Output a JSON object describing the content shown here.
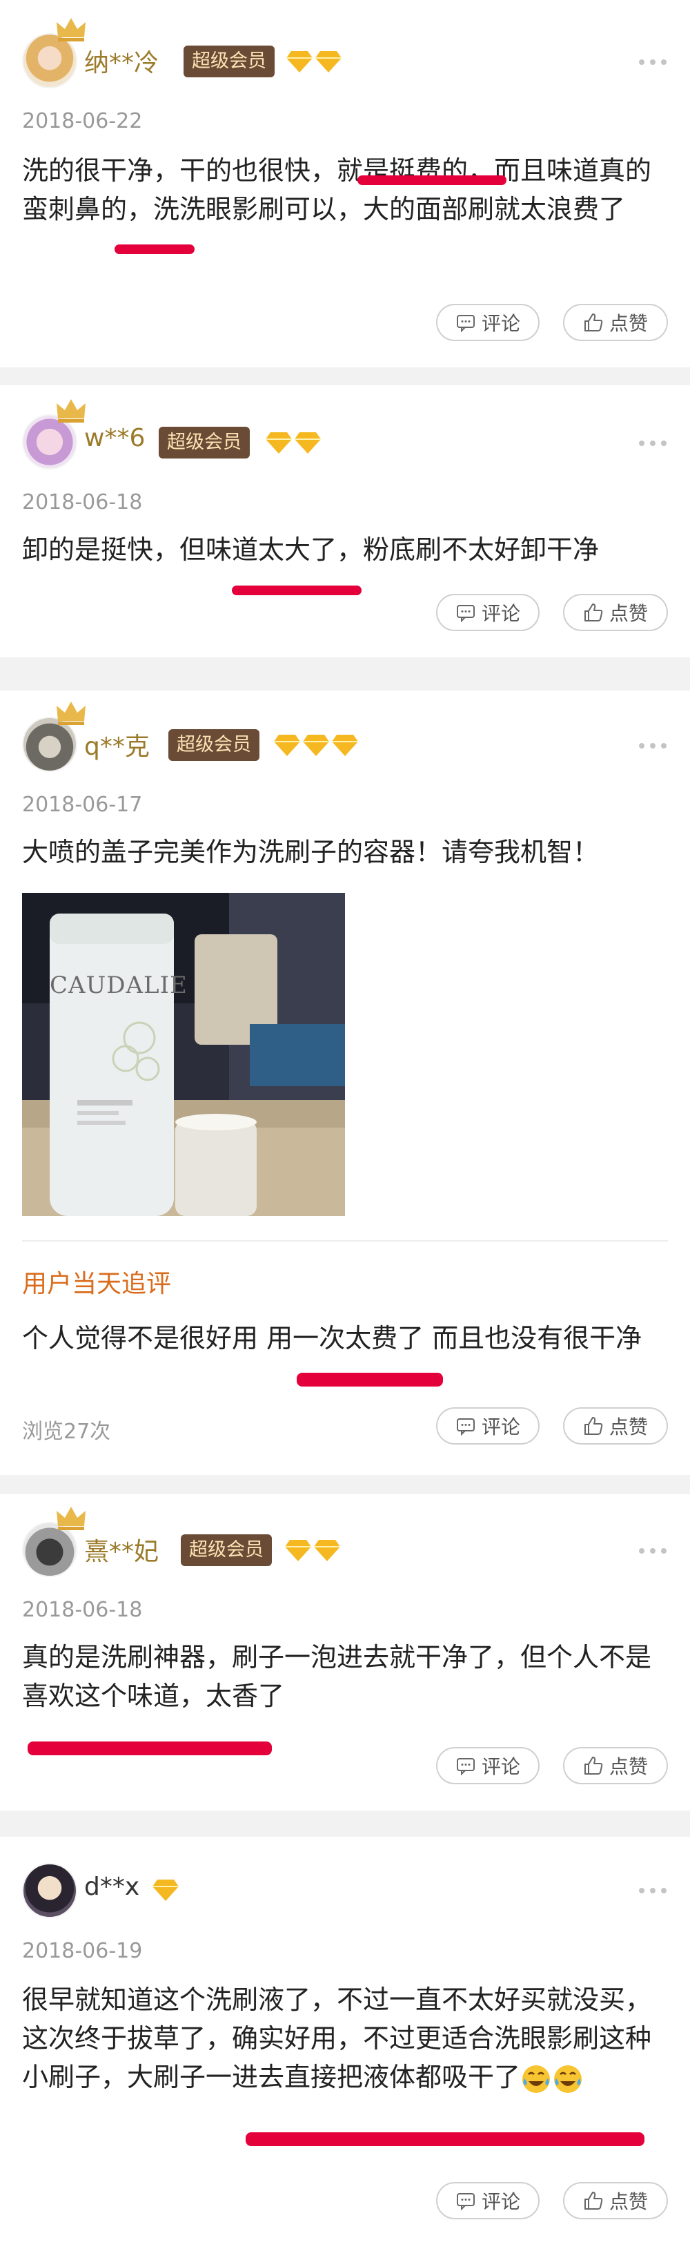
{
  "actions": {
    "comment_label": "评论",
    "like_label": "点赞"
  },
  "reviews": [
    {
      "username": "纳**冷",
      "badge": "超级会员",
      "date": "2018-06-22",
      "text": "洗的很干净，干的也很快，就是挺费的，而且味道真的蛮刺鼻的，洗洗眼影刷可以，大的面部刷就太浪费了"
    },
    {
      "username": "w**6",
      "badge": "超级会员",
      "date": "2018-06-18",
      "text": "卸的是挺快，但味道太大了，粉底刷不太好卸干净"
    },
    {
      "username": "q**克",
      "badge": "超级会员",
      "date": "2018-06-17",
      "text": "大喷的盖子完美作为洗刷子的容器！请夸我机智！",
      "photo_brand": "CAUDALIE",
      "followup_label": "用户当天追评",
      "followup_text": "个人觉得不是很好用 用一次太费了 而且也没有很干净",
      "views": "浏览27次"
    },
    {
      "username": "熹**妃",
      "badge": "超级会员",
      "date": "2018-06-18",
      "text": "真的是洗刷神器，刷子一泡进去就干净了，但个人不是喜欢这个味道，太香了"
    },
    {
      "username": "d**x",
      "date": "2018-06-19",
      "text": "很早就知道这个洗刷液了，不过一直不太好买就没买，这次终于拔草了，确实好用，不过更适合洗眼影刷这种小刷子，大刷子一进去直接把液体都吸干了"
    }
  ],
  "colors": {
    "accent_username": "#9b7b2a",
    "badge_bg": "#6a4b35",
    "badge_text": "#fbe3b4",
    "annotation_red": "#e4003b",
    "followup_orange": "#d96c1c"
  },
  "icons": [
    "crown-icon",
    "diamond-icon",
    "more-icon",
    "comment-icon",
    "thumbs-up-icon",
    "laugh-cry-emoji"
  ]
}
